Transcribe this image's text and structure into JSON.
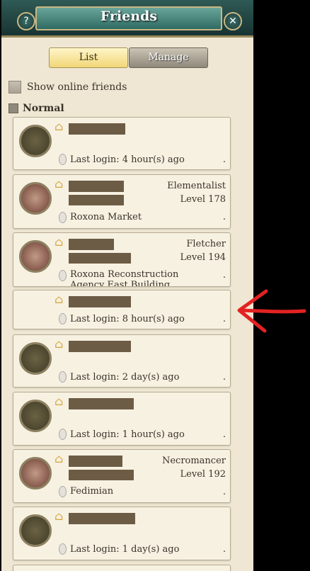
{
  "window": {
    "title": "Friends",
    "help_icon": "?",
    "close_icon": "✕"
  },
  "tabs": [
    {
      "label": "List",
      "active": true
    },
    {
      "label": "Manage",
      "active": false
    }
  ],
  "online_filter": {
    "label": "Show online friends",
    "checked": false
  },
  "group": {
    "label": "Normal"
  },
  "friends": [
    {
      "class": "",
      "level": "",
      "location": "Last login: 4 hour(s) ago"
    },
    {
      "class": "Elementalist",
      "level": "Level 178",
      "location": "Roxona Market"
    },
    {
      "class": "Fletcher",
      "level": "Level 194",
      "location": "Roxona Reconstruction Agency East Building"
    },
    {
      "class": "",
      "level": "",
      "location": "Last login: 8 hour(s) ago"
    },
    {
      "class": "",
      "level": "",
      "location": "Last login: 2 day(s) ago"
    },
    {
      "class": "",
      "level": "",
      "location": "Last login: 1 hour(s) ago"
    },
    {
      "class": "Necromancer",
      "level": "Level 192",
      "location": "Fedimian"
    },
    {
      "class": "",
      "level": "",
      "location": "Last login: 1 day(s) ago"
    }
  ],
  "list_dot": ".",
  "colors": {
    "annotation_arrow": "#e32222",
    "title_bar": "#2a4d48",
    "panel_bg": "#efe7d3"
  }
}
